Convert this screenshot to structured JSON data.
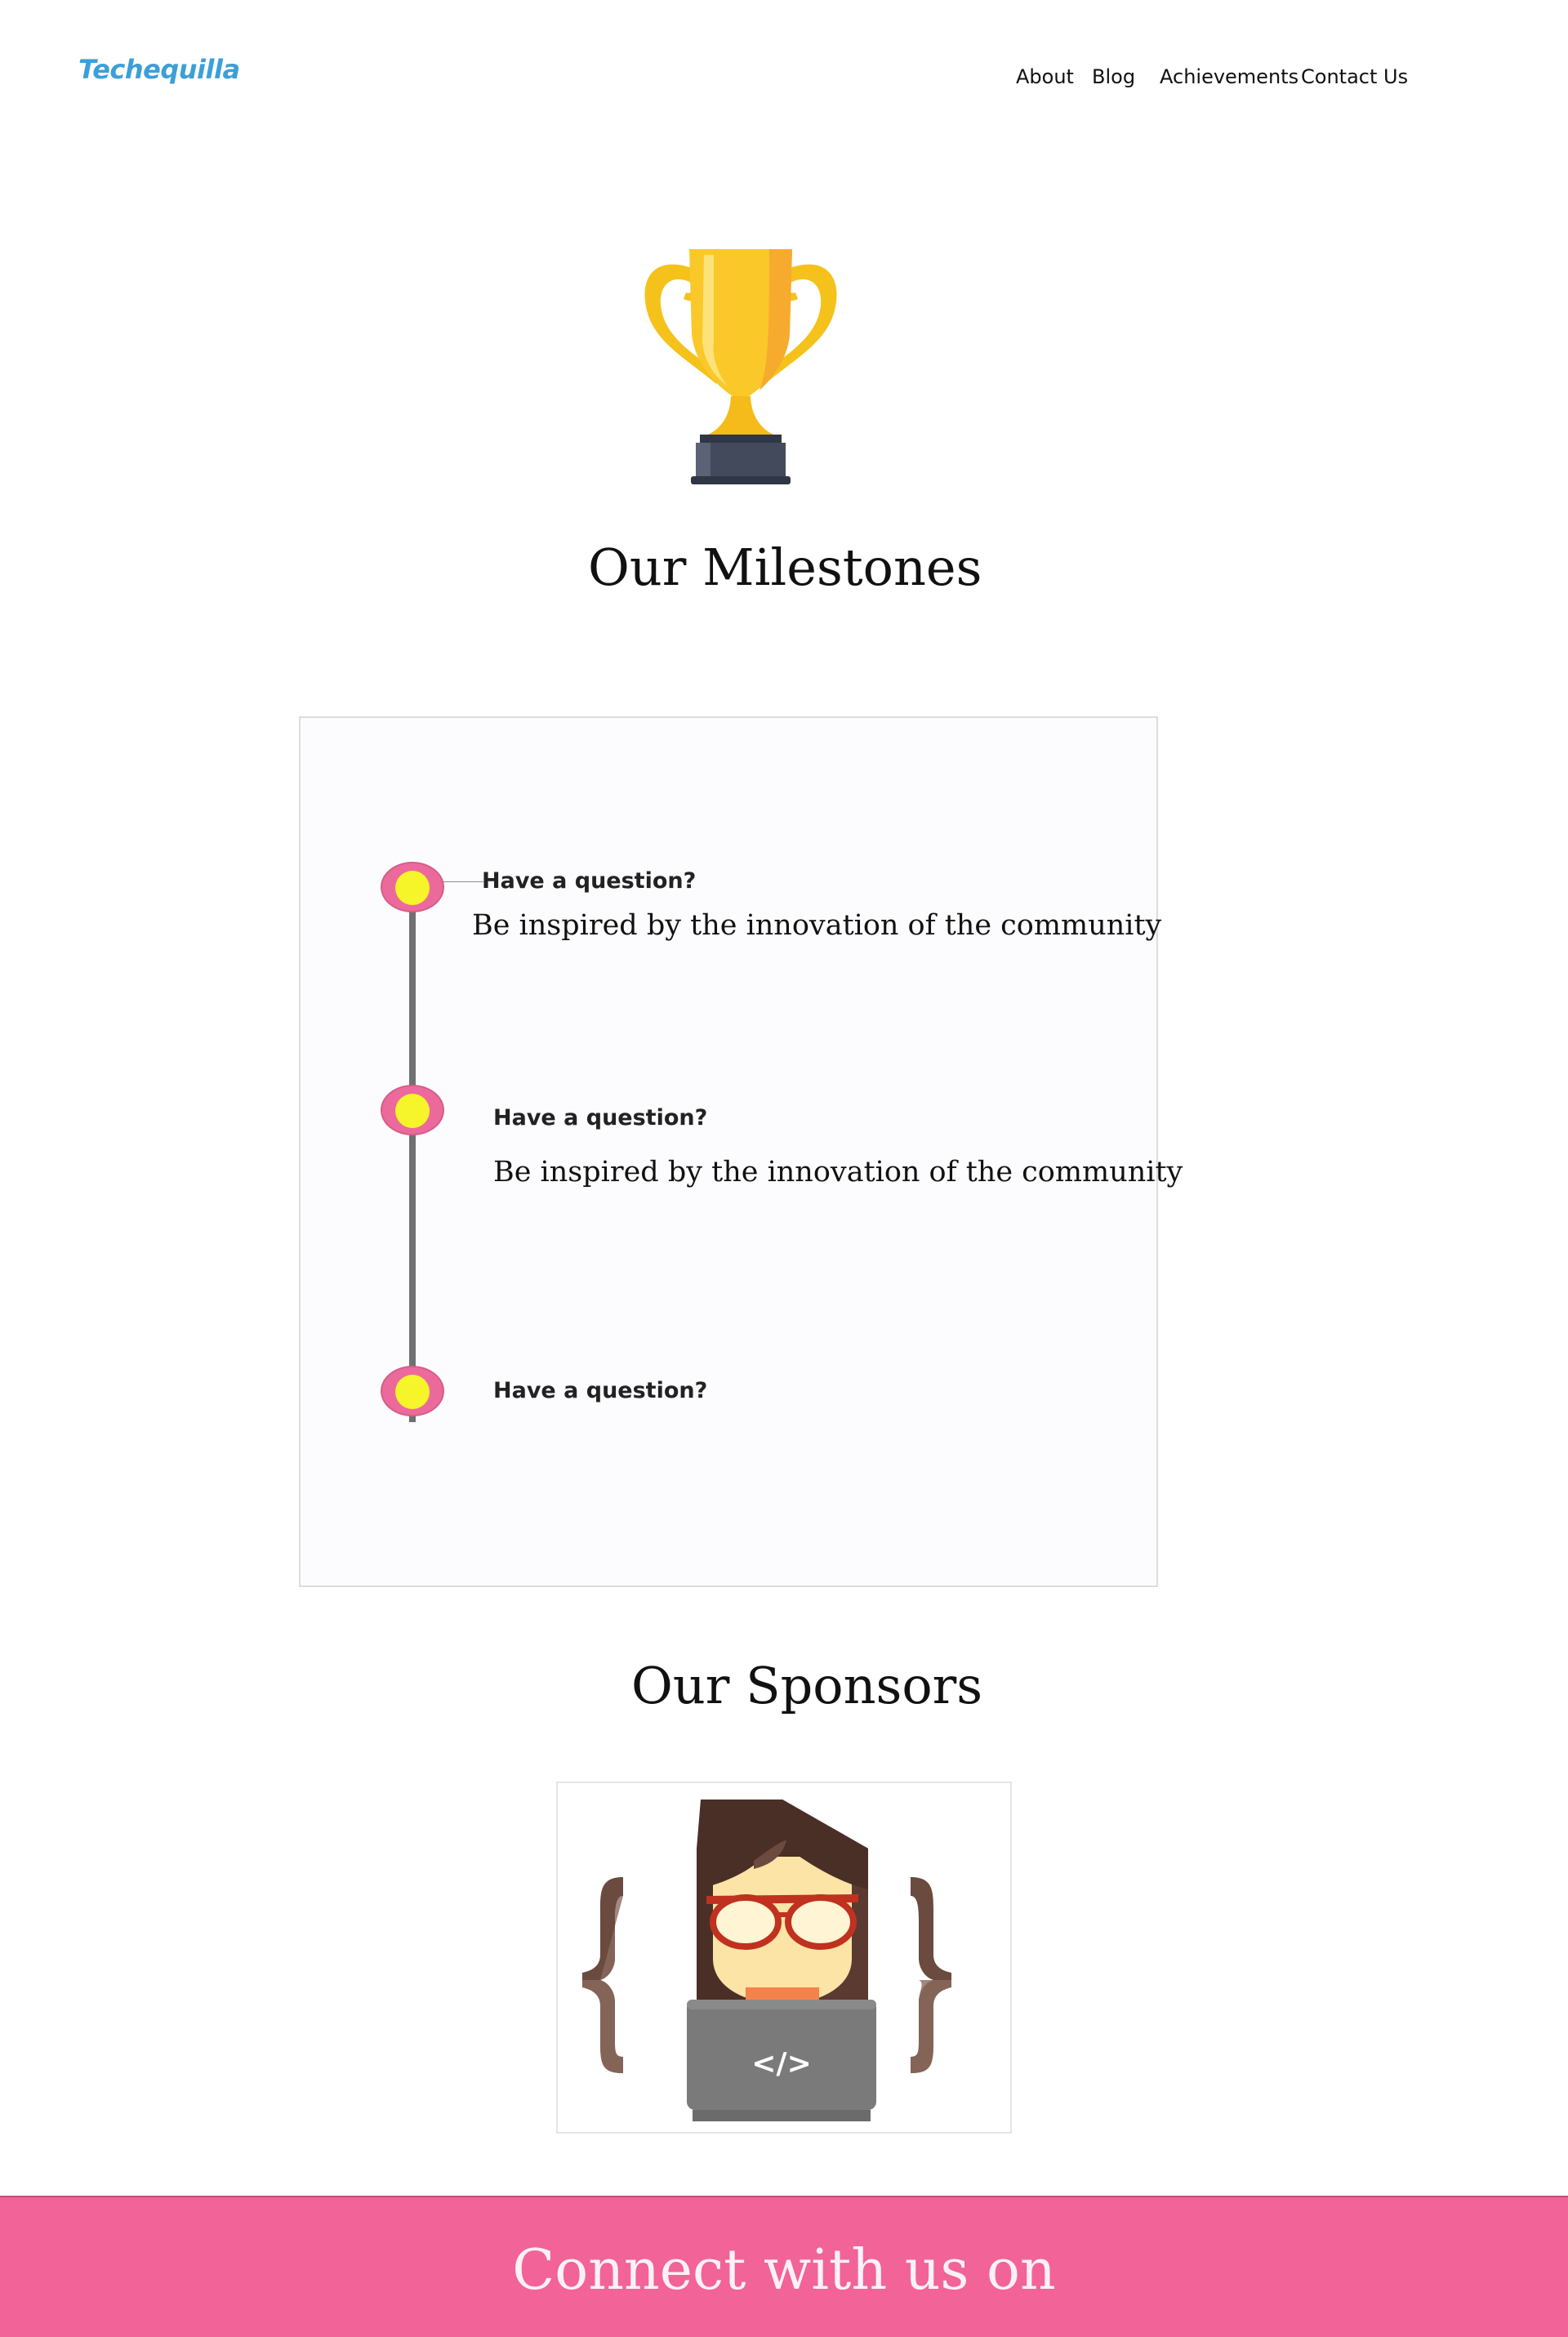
{
  "header": {
    "brand": "Techequilla",
    "nav": [
      {
        "label": "About"
      },
      {
        "label": "Blog"
      },
      {
        "label": "Achievements"
      },
      {
        "label": "Contact Us"
      }
    ]
  },
  "trophy": {
    "icon": "trophy-icon"
  },
  "milestones": {
    "title": "Our Milestones",
    "items": [
      {
        "question": "Have a question?",
        "description": "Be inspired by the innovation of the community"
      },
      {
        "question": "Have a question?",
        "description": "Be inspired by the innovation of the community"
      },
      {
        "question": "Have a question?"
      }
    ]
  },
  "sponsors": {
    "title": "Our Sponsors",
    "logo": "developer-girl-logo",
    "logo_code_glyph": "</>"
  },
  "footer": {
    "title": "Connect with us on"
  },
  "colors": {
    "brand": "#3d9fd8",
    "accent_pink": "#f26398",
    "node_pink": "#ec6a9b",
    "node_yellow": "#f6f52a",
    "timeline_gray": "#707070"
  }
}
